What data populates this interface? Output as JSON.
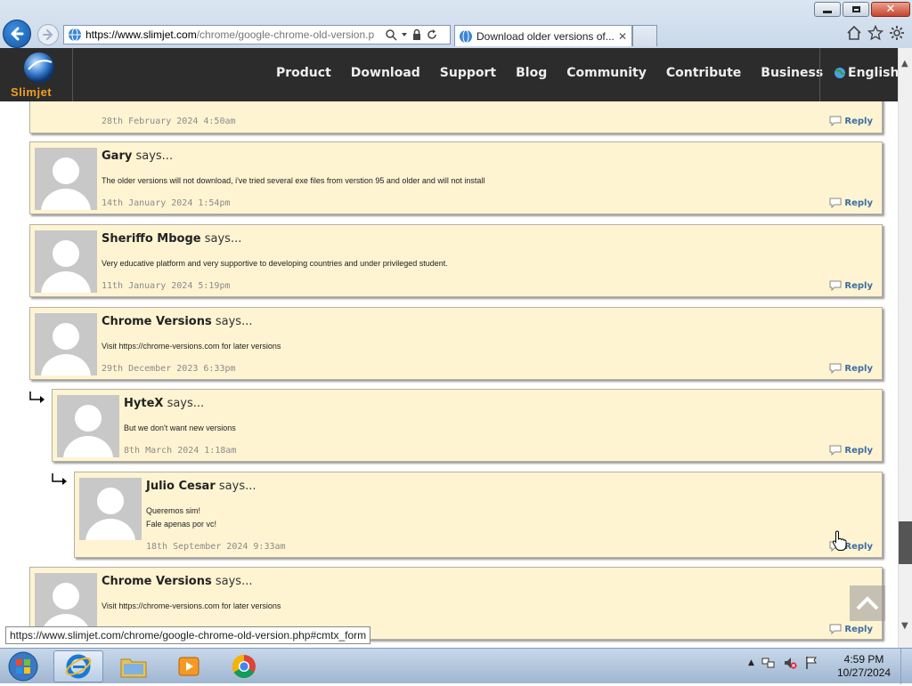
{
  "browser": {
    "url_scheme": "https://",
    "url_domain": "www.slimjet.com",
    "url_path": "/chrome/google-chrome-old-version.p",
    "tab_title": "Download older versions of...",
    "tab_close": "✕",
    "status_url": "https://www.slimjet.com/chrome/google-chrome-old-version.php#cmtx_form"
  },
  "site": {
    "logo_text": "Slimjet",
    "nav": [
      "Product",
      "Download",
      "Support",
      "Blog",
      "Community",
      "Contribute",
      "Business"
    ],
    "language": "English"
  },
  "comments": [
    {
      "author": "",
      "says": "",
      "text": [],
      "date": "28th February 2024 4:50am",
      "reply": "Reply",
      "depth": 0
    },
    {
      "author": "Gary",
      "says": "says...",
      "text": [
        "The older versions will not download, i've tried several exe files from verstion 95 and older and will not install"
      ],
      "date": "14th January 2024 1:54pm",
      "reply": "Reply",
      "depth": 0
    },
    {
      "author": "Sheriffo Mboge",
      "says": "says...",
      "text": [
        "Very educative platform and very supportive to developing countries and under privileged student."
      ],
      "date": "11th January 2024 5:19pm",
      "reply": "Reply",
      "depth": 0
    },
    {
      "author": "Chrome Versions",
      "says": "says...",
      "text": [
        "Visit https://chrome-versions.com for later versions"
      ],
      "date": "29th December 2023 6:33pm",
      "reply": "Reply",
      "depth": 0
    },
    {
      "author": "HyteX",
      "says": "says...",
      "text": [
        "But we don't want new versions"
      ],
      "date": "8th March 2024 1:18am",
      "reply": "Reply",
      "depth": 1
    },
    {
      "author": "Julio Cesar",
      "says": "says...",
      "text": [
        "Queremos sim!",
        "Fale apenas por vc!"
      ],
      "date": "18th September 2024 9:33am",
      "reply": "Reply",
      "depth": 2
    },
    {
      "author": "Chrome Versions",
      "says": "says...",
      "text": [
        "Visit https://chrome-versions.com for later versions"
      ],
      "date": "",
      "reply": "Reply",
      "depth": 0
    }
  ],
  "taskbar": {
    "time": "4:59 PM",
    "date": "10/27/2024"
  },
  "colors": {
    "comment_bg": "#fff4d2",
    "nav_bg": "#2c2c2c",
    "reply_link": "#3b6ea5",
    "logo_orange": "#f0a020"
  }
}
